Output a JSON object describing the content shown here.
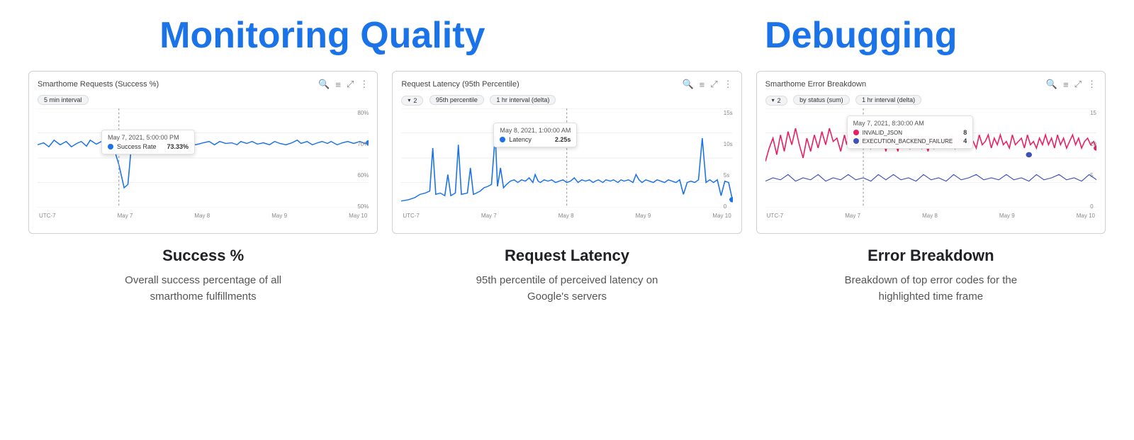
{
  "header": {
    "monitoring_title": "Monitoring Quality",
    "debugging_title": "Debugging"
  },
  "columns": [
    {
      "id": "success",
      "chart_title": "Smarthome Requests (Success %)",
      "chips": [
        "5 min interval"
      ],
      "chip_filter": null,
      "y_labels": [
        "80%",
        "70%",
        "60%",
        "50%"
      ],
      "x_labels": [
        "UTC-7",
        "May 7",
        "May 8",
        "May 9",
        "May 10"
      ],
      "tooltip_title": "May 7, 2021, 5:00:00 PM",
      "tooltip_series": "Success Rate",
      "tooltip_value": "73.33%",
      "tooltip_color": "#1a73e8",
      "label": "Success %",
      "description": "Overall success percentage of all smarthome fulfillments"
    },
    {
      "id": "latency",
      "chart_title": "Request Latency (95th Percentile)",
      "chips": [
        "95th percentile",
        "1 hr interval (delta)"
      ],
      "chip_filter": "2",
      "y_labels": [
        "15s",
        "10s",
        "5s",
        "0"
      ],
      "x_labels": [
        "UTC-7",
        "May 7",
        "May 8",
        "May 9",
        "May 10"
      ],
      "tooltip_title": "May 8, 2021, 1:00:00 AM",
      "tooltip_series": "Latency",
      "tooltip_value": "2.25s",
      "tooltip_color": "#1a73e8",
      "label": "Request Latency",
      "description": "95th percentile of perceived latency on Google's servers"
    },
    {
      "id": "errors",
      "chart_title": "Smarthome Error Breakdown",
      "chips": [
        "by status (sum)",
        "1 hr interval (delta)"
      ],
      "chip_filter": "2",
      "y_labels": [
        "15",
        "10",
        "5",
        "0"
      ],
      "x_labels": [
        "UTC-7",
        "May 7",
        "May 8",
        "May 9",
        "May 10"
      ],
      "tooltip_title": "May 7, 2021, 8:30:00 AM",
      "tooltip_rows": [
        {
          "series": "INVALID_JSON",
          "value": "8",
          "color": "#e91e63"
        },
        {
          "series": "EXECUTION_BACKEND_FAILURE",
          "value": "4",
          "color": "#3f51b5"
        }
      ],
      "label": "Error Breakdown",
      "description": "Breakdown of top error codes for the highlighted time frame"
    }
  ]
}
